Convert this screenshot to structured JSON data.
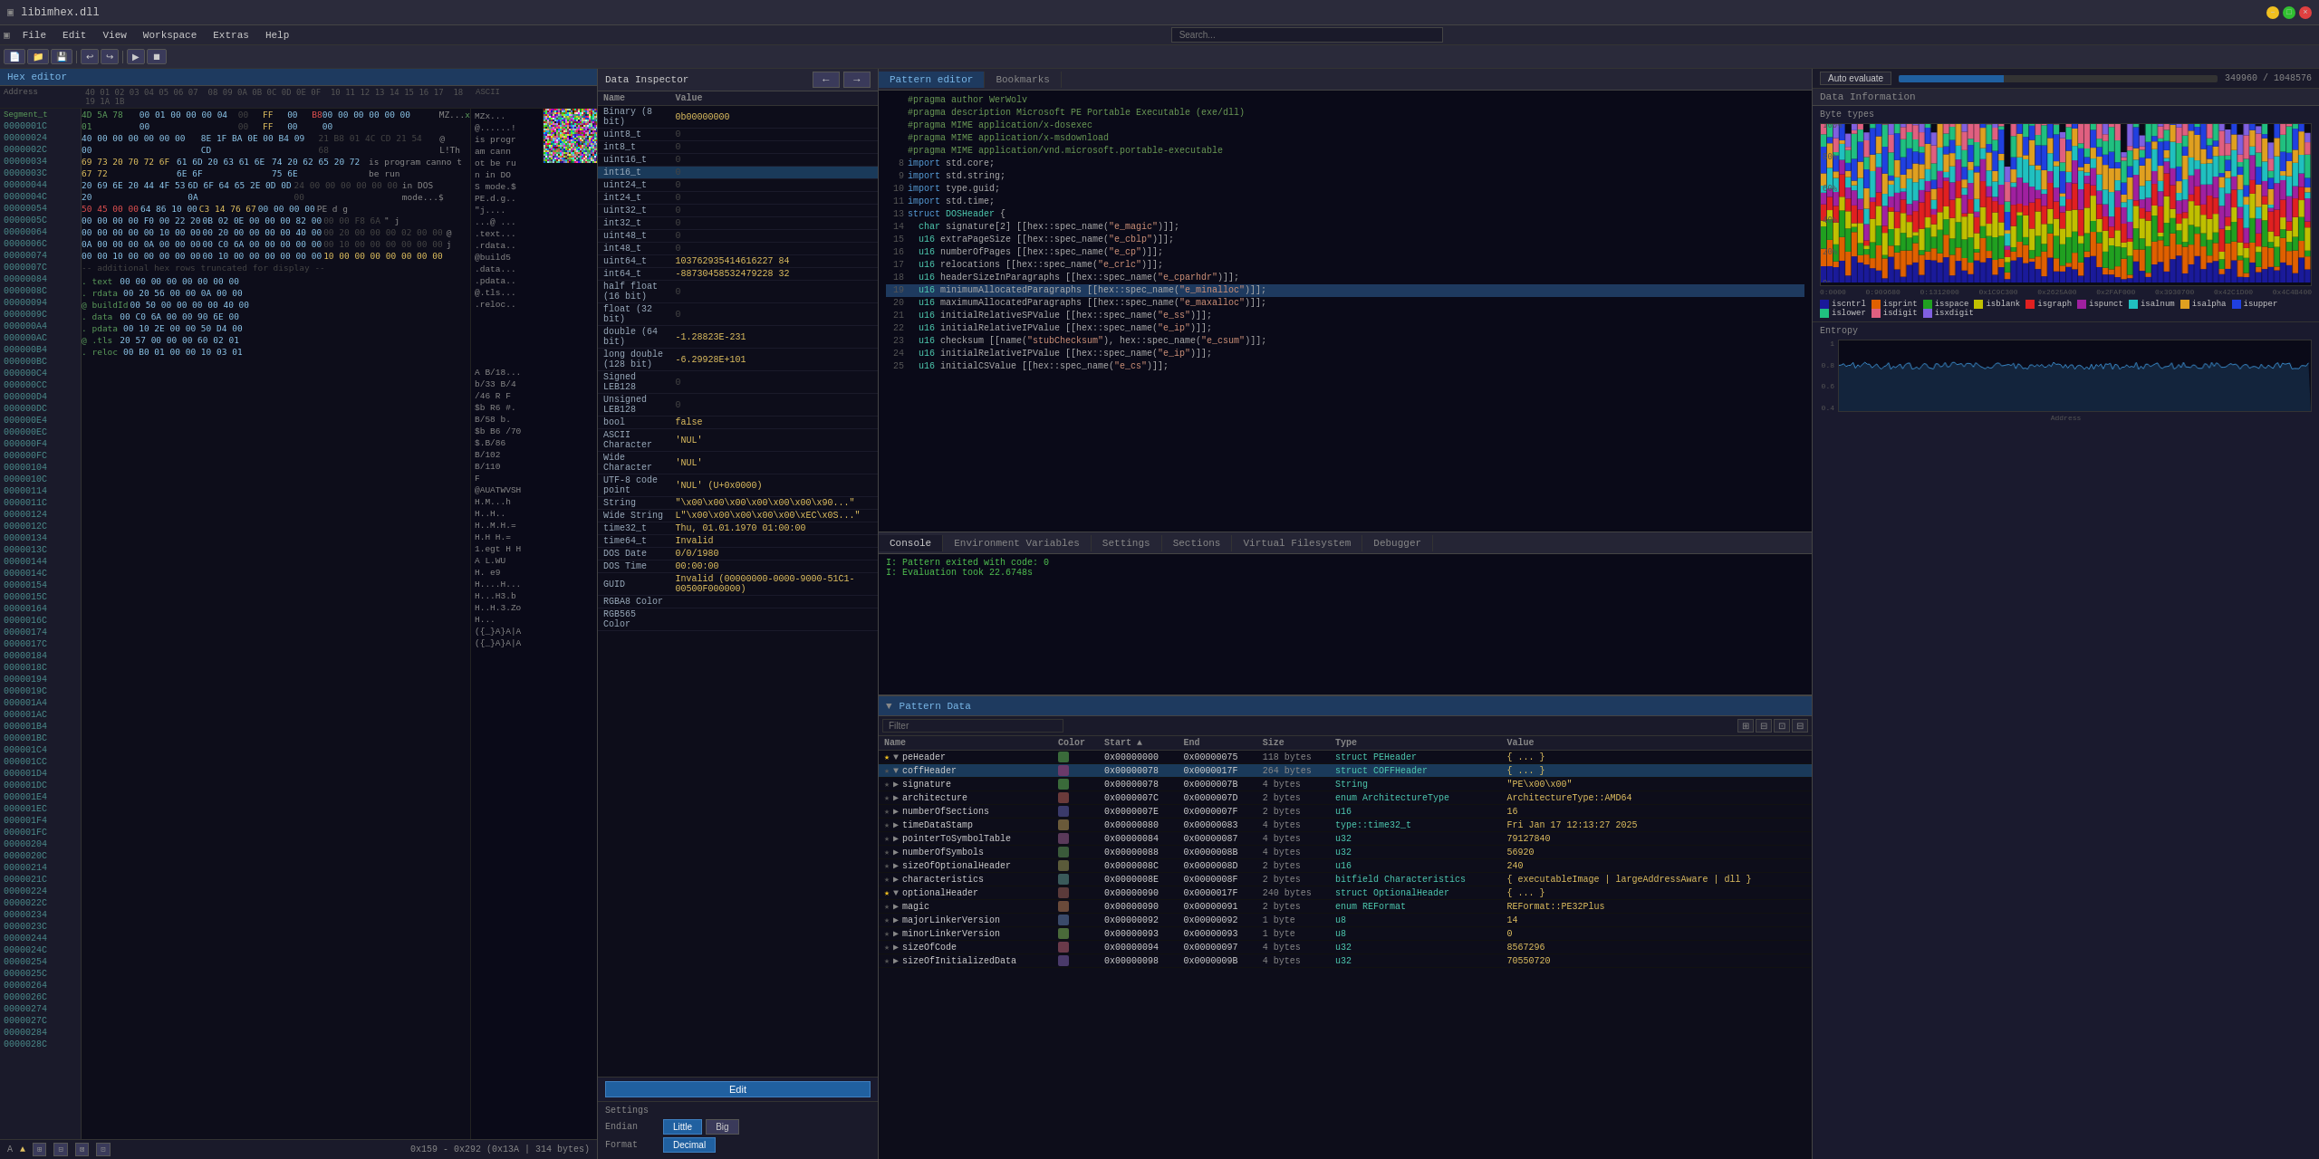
{
  "window": {
    "title": "libimhex.dll",
    "menu": [
      "File",
      "Edit",
      "View",
      "Workspace",
      "Extras",
      "Help"
    ]
  },
  "hex_editor": {
    "title": "Hex editor",
    "header_row": "Address  40 01 02 03 04 05 06 07  08 09 0A 0B 0C 0D 0E 0F  10 11 12 13 14 15 16 17  18 19 1A 1B  ASCII",
    "status": "0x159 - 0x292 (0x13A | 314 bytes)",
    "segment_label": "Segment_t",
    "mz_label": "MZ"
  },
  "data_inspector": {
    "title": "Data Inspector",
    "nav_prev": "←",
    "nav_next": "→",
    "columns": [
      "Name",
      "Value"
    ],
    "rows": [
      {
        "name": "Binary (8 bit)",
        "value": "0b00000000"
      },
      {
        "name": "uint8_t",
        "value": "0",
        "zero": true
      },
      {
        "name": "int8_t",
        "value": "0",
        "zero": true
      },
      {
        "name": "uint16_t",
        "value": "0",
        "zero": true
      },
      {
        "name": "int16_t",
        "value": "0",
        "zero": true,
        "selected": true
      },
      {
        "name": "uint24_t",
        "value": "0",
        "zero": true
      },
      {
        "name": "int24_t",
        "value": "0",
        "zero": true
      },
      {
        "name": "uint32_t",
        "value": "0",
        "zero": true
      },
      {
        "name": "int32_t",
        "value": "0",
        "zero": true
      },
      {
        "name": "uint48_t",
        "value": "0",
        "zero": true
      },
      {
        "name": "int48_t",
        "value": "0",
        "zero": true
      },
      {
        "name": "uint64_t",
        "value": "103762935414616227 84"
      },
      {
        "name": "int64_t",
        "value": "-88730458532479228 32"
      },
      {
        "name": "half float (16 bit)",
        "value": "0",
        "zero": true
      },
      {
        "name": "float (32 bit)",
        "value": "0",
        "zero": true
      },
      {
        "name": "double (64 bit)",
        "value": "-1.28823E-231"
      },
      {
        "name": "long double (128 bit)",
        "value": "-6.29928E+101"
      },
      {
        "name": "Signed LEB128",
        "value": "0",
        "zero": true
      },
      {
        "name": "Unsigned LEB128",
        "value": "0",
        "zero": true
      },
      {
        "name": "bool",
        "value": "false"
      },
      {
        "name": "ASCII Character",
        "value": "'NUL'"
      },
      {
        "name": "Wide Character",
        "value": "'NUL'"
      },
      {
        "name": "UTF-8 code point",
        "value": "'NUL' (U+0x0000)"
      },
      {
        "name": "String",
        "value": "\"\\x00\\x00\\x00\\x00\\x00\\x00\\x90...\""
      },
      {
        "name": "Wide String",
        "value": "L\"\\x00\\x00\\x00\\x00\\x00\\xEC\\x0S...\""
      },
      {
        "name": "time32_t",
        "value": "Thu, 01.01.1970 01:00:00"
      },
      {
        "name": "time64_t",
        "value": "Invalid"
      },
      {
        "name": "DOS Date",
        "value": "0/0/1980"
      },
      {
        "name": "DOS Time",
        "value": "00:00:00"
      },
      {
        "name": "GUID",
        "value": "Invalid (00000000-0000-9000-51C1-00500F000000)"
      },
      {
        "name": "RGBA8 Color",
        "value": ""
      },
      {
        "name": "RGB565 Color",
        "value": ""
      }
    ],
    "edit_button": "Edit",
    "settings_label": "Settings",
    "endian_label": "Endian",
    "endian_little": "Little",
    "endian_big": "Big",
    "format_label": "Format",
    "format_decimal": "Decimal"
  },
  "pattern_editor": {
    "tabs": [
      "Pattern editor",
      "Bookmarks"
    ],
    "active_tab": "Pattern editor",
    "code_lines": [
      {
        "num": "",
        "text": "#pragma author WerWolv",
        "type": "comment"
      },
      {
        "num": "",
        "text": "#pragma description Microsoft PE Portable Executable (exe/dll)",
        "type": "comment"
      },
      {
        "num": "",
        "text": "",
        "type": "blank"
      },
      {
        "num": "",
        "text": "#pragma MIME application/x-dosexec",
        "type": "comment"
      },
      {
        "num": "",
        "text": "#pragma MIME application/x-msdownload",
        "type": "comment"
      },
      {
        "num": "",
        "text": "#pragma MIME application/vnd.microsoft.portable-executable",
        "type": "comment"
      },
      {
        "num": "",
        "text": "",
        "type": "blank"
      },
      {
        "num": "8",
        "text": "import std.core;",
        "type": "code"
      },
      {
        "num": "9",
        "text": "import std.string;",
        "type": "code"
      },
      {
        "num": "10",
        "text": "import type.guid;",
        "type": "code"
      },
      {
        "num": "11",
        "text": "import std.time;",
        "type": "code"
      },
      {
        "num": "",
        "text": "",
        "type": "blank"
      },
      {
        "num": "13",
        "text": "struct DOSHeader {",
        "type": "code"
      },
      {
        "num": "14",
        "text": "  char signature[2] [[hex::spec_name(\"e_magic\")]];",
        "type": "code"
      },
      {
        "num": "15",
        "text": "  u16 extraPageSize [[hex::spec_name(\"e_cblp\")]];",
        "type": "code"
      },
      {
        "num": "16",
        "text": "  u16 numberOfPages [[hex::spec_name(\"e_cp\")]];",
        "type": "code"
      },
      {
        "num": "17",
        "text": "  u16 relocations [[hex::spec_name(\"e_crlc\")]];",
        "type": "code"
      },
      {
        "num": "18",
        "text": "  u16 headerSizeInParagraphs [[hex::spec_name(\"e_cparhdr\")]];",
        "type": "code"
      },
      {
        "num": "19",
        "text": "  u16 minimumAllocatedParagraphs [[hex::spec_name(\"e_minalloc\")]];",
        "type": "highlight"
      },
      {
        "num": "20",
        "text": "  u16 maximumAllocatedParagraphs [[hex::spec_name(\"e_maxalloc\")]];",
        "type": "code"
      },
      {
        "num": "21",
        "text": "  u16 initialRelativeSPValue [[hex::spec_name(\"e_ss\")]];",
        "type": "code"
      },
      {
        "num": "22",
        "text": "  u16 initialRelativeIPValue [[hex::spec_name(\"e_ip\")]];",
        "type": "code"
      },
      {
        "num": "23",
        "text": "  u16 checksum [[name(\"stubChecksum\"), hex::spec_name(\"e_csum\")]];",
        "type": "code"
      },
      {
        "num": "24",
        "text": "  u16 initialRelativeIPValue [[hex::spec_name(\"e_ip\")]];",
        "type": "code"
      },
      {
        "num": "25",
        "text": "  u16 initialCSValue [[hex::spec_name(\"e_cs\")]];",
        "type": "code"
      }
    ]
  },
  "console": {
    "tabs": [
      "Console",
      "Environment Variables",
      "Settings",
      "Sections",
      "Virtual Filesystem",
      "Debugger"
    ],
    "active_tab": "Console",
    "lines": [
      "I: Pattern exited with code: 0",
      "I: Evaluation took 22.6748s"
    ]
  },
  "auto_evaluate": {
    "label": "Auto evaluate",
    "progress": "349960 / 1048576",
    "btn_label": "Auto evaluate"
  },
  "data_information": {
    "title": "Data Information",
    "byte_types_title": "Byte types",
    "entropy_title": "Entropy",
    "x_axis_labels": [
      "0:0000",
      "0:909680",
      "0:1312000",
      "0x1C9C300",
      "0x2625A00",
      "0x2FAF000",
      "0x3930700",
      "0x42C1D00",
      "0x4C4B400"
    ],
    "legend": [
      {
        "label": "iscntrl",
        "color": "#1a1a9a"
      },
      {
        "label": "isprint",
        "color": "#e06000"
      },
      {
        "label": "isspace",
        "color": "#20a020"
      },
      {
        "label": "isblank",
        "color": "#c0c000"
      },
      {
        "label": "isgraph",
        "color": "#e02020"
      },
      {
        "label": "ispunct",
        "color": "#a020a0"
      },
      {
        "label": "isalnum",
        "color": "#20c0c0"
      },
      {
        "label": "isalpha",
        "color": "#e0a020"
      },
      {
        "label": "isupper",
        "color": "#2040e0"
      },
      {
        "label": "islower",
        "color": "#20c080"
      },
      {
        "label": "isdigit",
        "color": "#e06080"
      },
      {
        "label": "isxdigit",
        "color": "#8060e0"
      }
    ]
  },
  "pattern_data": {
    "title": "Pattern Data",
    "filter_placeholder": "Filter",
    "columns": [
      "Name",
      "Color",
      "Start",
      "End",
      "Size",
      "Type",
      "Value"
    ],
    "rows": [
      {
        "expand": true,
        "star": true,
        "name": "peHeader",
        "color": "#3a6a3a",
        "start": "0x00000000",
        "end": "0x00000075",
        "size": "118 bytes",
        "type": "struct PEHeader",
        "value": "{ ... }"
      },
      {
        "expand": true,
        "star": false,
        "name": "coffHeader",
        "color": "#6a3a6a",
        "start": "0x00000078",
        "end": "0x0000017F",
        "size": "264 bytes",
        "type": "struct COFFHeader",
        "value": "{ ... }",
        "highlight": true
      },
      {
        "expand": false,
        "star": false,
        "name": "signature",
        "color": "#3a6a3a",
        "start": "0x00000078",
        "end": "0x0000007B",
        "size": "4 bytes",
        "type": "String",
        "value": "\"PE\\x00\\x00\""
      },
      {
        "expand": false,
        "star": false,
        "name": "architecture",
        "color": "#6a3a3a",
        "start": "0x0000007C",
        "end": "0x0000007D",
        "size": "2 bytes",
        "type": "enum ArchitectureType",
        "value": "ArchitectureType::AMD64"
      },
      {
        "expand": false,
        "star": false,
        "name": "numberOfSections",
        "color": "#3a3a6a",
        "start": "0x0000007E",
        "end": "0x0000007F",
        "size": "2 bytes",
        "type": "u16",
        "value": "16"
      },
      {
        "expand": false,
        "star": false,
        "name": "timeDataStamp",
        "color": "#6a5a3a",
        "start": "0x00000080",
        "end": "0x00000083",
        "size": "4 bytes",
        "type": "type::time32_t",
        "value": "Fri Jan 17 12:13:27 2025"
      },
      {
        "expand": false,
        "star": false,
        "name": "pointerToSymbolTable",
        "color": "#5a3a5a",
        "start": "0x00000084",
        "end": "0x00000087",
        "size": "4 bytes",
        "type": "u32",
        "value": "79127840"
      },
      {
        "expand": false,
        "star": false,
        "name": "numberOfSymbols",
        "color": "#3a5a3a",
        "start": "0x00000088",
        "end": "0x0000008B",
        "size": "4 bytes",
        "type": "u32",
        "value": "56920"
      },
      {
        "expand": false,
        "star": false,
        "name": "sizeOfOptionalHeader",
        "color": "#5a5a3a",
        "start": "0x0000008C",
        "end": "0x0000008D",
        "size": "2 bytes",
        "type": "u16",
        "value": "240"
      },
      {
        "expand": false,
        "star": false,
        "name": "characteristics",
        "color": "#3a5a5a",
        "start": "0x0000008E",
        "end": "0x0000008F",
        "size": "2 bytes",
        "type": "bitfield Characteristics",
        "value": "{ executableImage | largeAddressAware | dll }"
      },
      {
        "expand": true,
        "star": true,
        "name": "optionalHeader",
        "color": "#5a3a3a",
        "start": "0x00000090",
        "end": "0x0000017F",
        "size": "240 bytes",
        "type": "struct OptionalHeader",
        "value": "{ ... }"
      },
      {
        "expand": false,
        "star": false,
        "name": "magic",
        "color": "#6a4a3a",
        "start": "0x00000090",
        "end": "0x00000091",
        "size": "2 bytes",
        "type": "enum REFormat",
        "value": "REFormat::PE32Plus"
      },
      {
        "expand": false,
        "star": false,
        "name": "majorLinkerVersion",
        "color": "#3a4a6a",
        "start": "0x00000092",
        "end": "0x00000092",
        "size": "1 byte",
        "type": "u8",
        "value": "14"
      },
      {
        "expand": false,
        "star": false,
        "name": "minorLinkerVersion",
        "color": "#4a6a3a",
        "start": "0x00000093",
        "end": "0x00000093",
        "size": "1 byte",
        "type": "u8",
        "value": "0"
      },
      {
        "expand": false,
        "star": false,
        "name": "sizeOfCode",
        "color": "#6a3a4a",
        "start": "0x00000094",
        "end": "0x00000097",
        "size": "4 bytes",
        "type": "u32",
        "value": "8567296"
      },
      {
        "expand": false,
        "star": false,
        "name": "sizeOfInitializedData",
        "color": "#4a3a6a",
        "start": "0x00000098",
        "end": "0x0000009B",
        "size": "4 bytes",
        "type": "u32",
        "value": "70550720"
      }
    ]
  }
}
